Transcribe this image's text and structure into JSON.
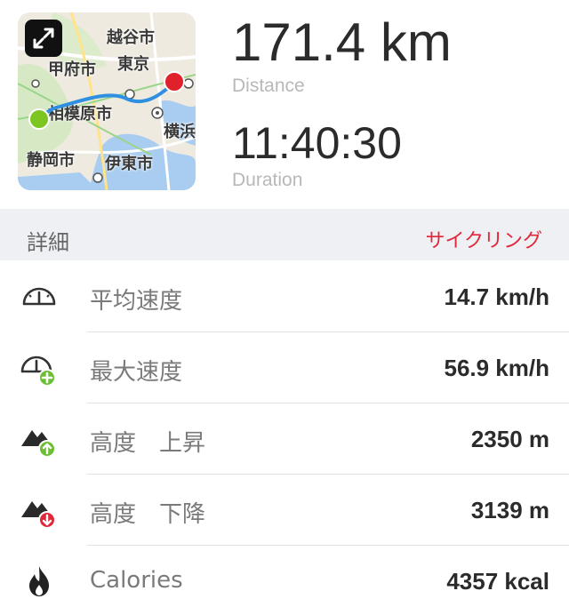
{
  "map": {
    "labels": [
      "越谷市",
      "東京",
      "甲府市",
      "相模原市",
      "横浜",
      "静岡市",
      "伊東市"
    ],
    "start_color": "#7dc621",
    "end_color": "#e0202a",
    "route_color": "#2f8fe0"
  },
  "summary": {
    "distance_value": "171.4 km",
    "distance_label": "Distance",
    "duration_value": "11:40:30",
    "duration_label": "Duration"
  },
  "details": {
    "title": "詳細",
    "activity_type": "サイクリング",
    "accent_color": "#e0283a",
    "rows": [
      {
        "label": "平均速度",
        "value": "14.7 km/h",
        "icon": "speedometer-icon"
      },
      {
        "label": "最大速度",
        "value": "56.9 km/h",
        "icon": "max-speed-icon"
      },
      {
        "label": "高度　上昇",
        "value": "2350 m",
        "icon": "elevation-up-icon"
      },
      {
        "label": "高度　下降",
        "value": "3139 m",
        "icon": "elevation-down-icon"
      },
      {
        "label": "Calories",
        "value": "4357 kcal",
        "icon": "flame-icon"
      }
    ]
  }
}
